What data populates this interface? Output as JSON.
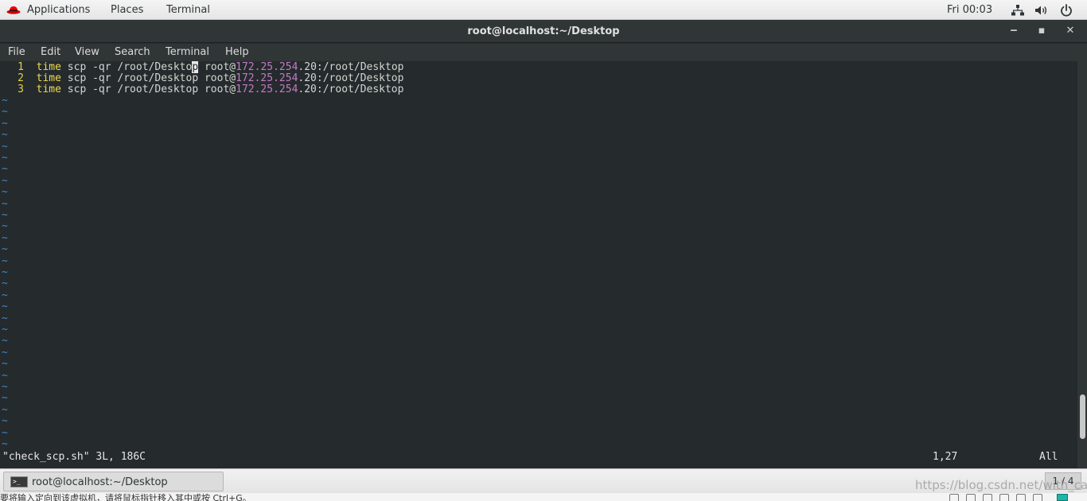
{
  "top_panel": {
    "applications": "Applications",
    "places": "Places",
    "terminal": "Terminal",
    "clock": "Fri 00:03",
    "icons": [
      "redhat-logo-icon",
      "network-icon",
      "volume-icon",
      "power-icon"
    ]
  },
  "window": {
    "title": "root@localhost:~/Desktop",
    "minimize": "‒",
    "maximize": "▪",
    "close": "✕"
  },
  "menu": [
    "File",
    "Edit",
    "View",
    "Search",
    "Terminal",
    "Help"
  ],
  "editor": {
    "lines": [
      {
        "num": "1",
        "cmd": "time",
        "before_ip": " scp -qr /root/Deskto",
        "cursor_char": "p",
        "after_cursor": " root@",
        "ip": "172.25.254",
        "tail": ".20:/root/Desktop"
      },
      {
        "num": "2",
        "cmd": "time",
        "before_ip": " scp -qr /root/Desktop root@",
        "ip": "172.25.254",
        "tail": ".20:/root/Desktop"
      },
      {
        "num": "3",
        "cmd": "time",
        "before_ip": " scp -qr /root/Desktop root@",
        "ip": "172.25.254",
        "tail": ".20:/root/Desktop"
      }
    ],
    "tilde": "~",
    "status_file": "\"check_scp.sh\" 3L, 186C",
    "status_position": "1,27",
    "status_percent": "All"
  },
  "taskbar": {
    "task_label": "root@localhost:~/Desktop",
    "task_icon_glyph": ">_",
    "workspace": "1 / 4",
    "watermark": "https://blog.csdn.net/with_cat"
  },
  "vm_hint": {
    "text": "要将输入定向到该虚拟机，请将鼠标指针移入其中或按 Ctrl+G。"
  },
  "colors": {
    "terminal_bg": "#252a2d",
    "line_number": "#e5d047",
    "keyword": "#f0dc4e",
    "ip_highlight": "#c37bc4",
    "tilde": "#3f88c8"
  }
}
